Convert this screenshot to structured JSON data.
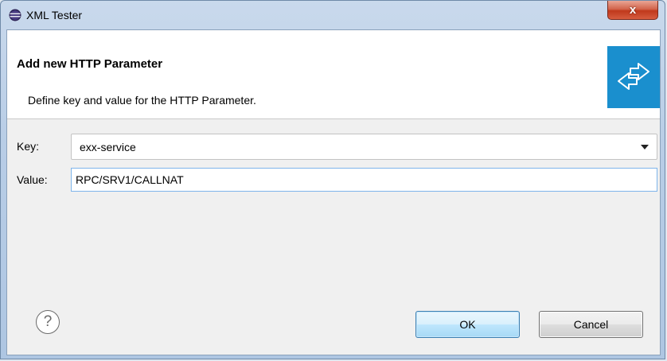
{
  "window": {
    "title": "XML Tester",
    "close_label": "x"
  },
  "header": {
    "title": "Add new HTTP Parameter",
    "description": "Define key and value for the HTTP Parameter."
  },
  "form": {
    "key_label": "Key:",
    "key_value": "exx-service",
    "value_label": "Value:",
    "value_value": "RPC/SRV1/CALLNAT"
  },
  "buttons": {
    "help_label": "?",
    "ok_label": "OK",
    "cancel_label": "Cancel"
  },
  "icons": {
    "app": "eclipse-icon",
    "banner": "swap-arrows-icon",
    "help": "help-icon",
    "dropdown": "chevron-down-icon"
  },
  "colors": {
    "banner": "#1a8fce",
    "close": "#c0391c"
  }
}
